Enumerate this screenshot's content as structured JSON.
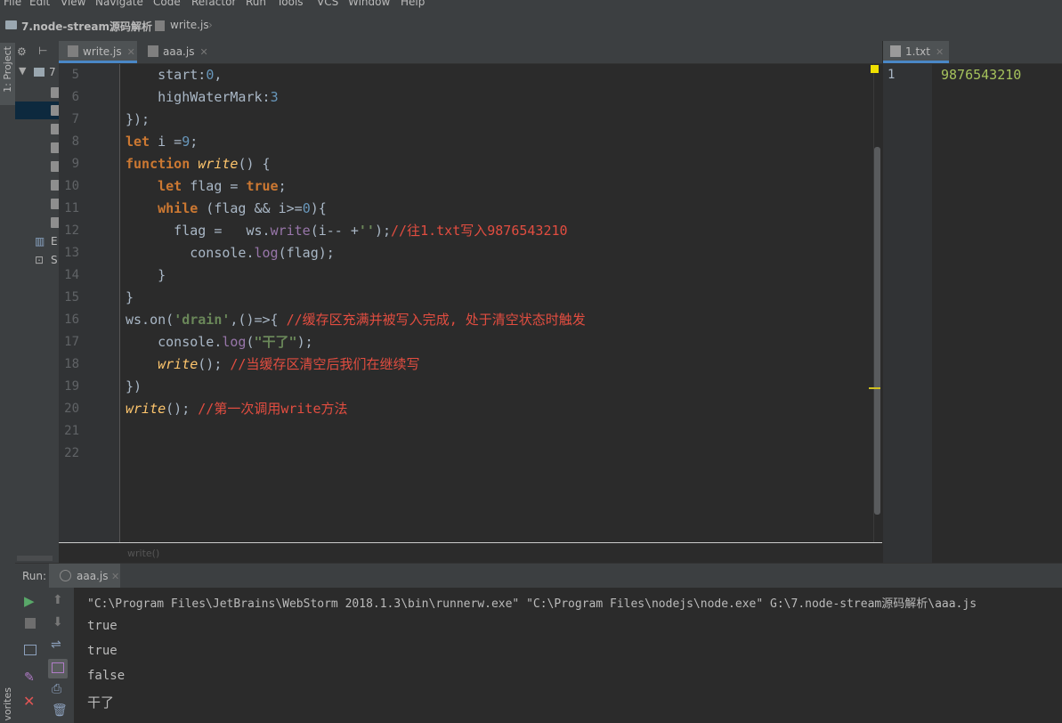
{
  "menu": [
    "File",
    "Edit",
    "View",
    "Navigate",
    "Code",
    "Refactor",
    "Run",
    "Tools",
    "VCS",
    "Window",
    "Help"
  ],
  "breadcrumb": {
    "project": "7.node-stream源码解析",
    "file": "write.js"
  },
  "left_strip": {
    "project_tab": "1: Project",
    "favorites_tab": "vorites"
  },
  "project_panel": {
    "root_label": "7",
    "items": [
      "E",
      "S"
    ]
  },
  "editor": {
    "tabs": [
      {
        "label": "write.js",
        "active": true
      },
      {
        "label": "aaa.js",
        "active": false
      }
    ],
    "line_numbers": [
      "5",
      "6",
      "7",
      "8",
      "9",
      "10",
      "11",
      "12",
      "13",
      "14",
      "15",
      "16",
      "17",
      "18",
      "19",
      "20",
      "21",
      "22"
    ],
    "lines": [
      "    start:0,",
      "    highWaterMark:3",
      "});",
      "let i =9;",
      "function write() {",
      "    let flag = true;",
      "    while (flag && i>=0){",
      "      flag =   ws.write(i-- +'');//往1.txt写入9876543210",
      "        console.log(flag);",
      "    }",
      "}",
      "ws.on('drain',()=>{ //缓存区充满并被写入完成, 处于清空状态时触发",
      "    console.log(\"干了\");",
      "    write(); //当缓存区清空后我们在继续写",
      "})",
      "write(); //第一次调用write方法",
      "",
      ""
    ],
    "status_fn": "write()"
  },
  "right_panel": {
    "tab": "1.txt",
    "line_number": "1",
    "content": "9876543210"
  },
  "run": {
    "label": "Run:",
    "tab": "aaa.js",
    "command": "\"C:\\Program Files\\JetBrains\\WebStorm 2018.1.3\\bin\\runnerw.exe\" \"C:\\Program Files\\nodejs\\node.exe\" G:\\7.node-stream源码解析\\aaa.js",
    "output": [
      "true",
      "true",
      "false",
      "干了"
    ]
  },
  "colors": {
    "keyword": "#cc7832",
    "number": "#6897bb",
    "string": "#6a8759",
    "comment": "#e24d40",
    "function": "#ffc66d",
    "background": "#2b2b2b"
  }
}
